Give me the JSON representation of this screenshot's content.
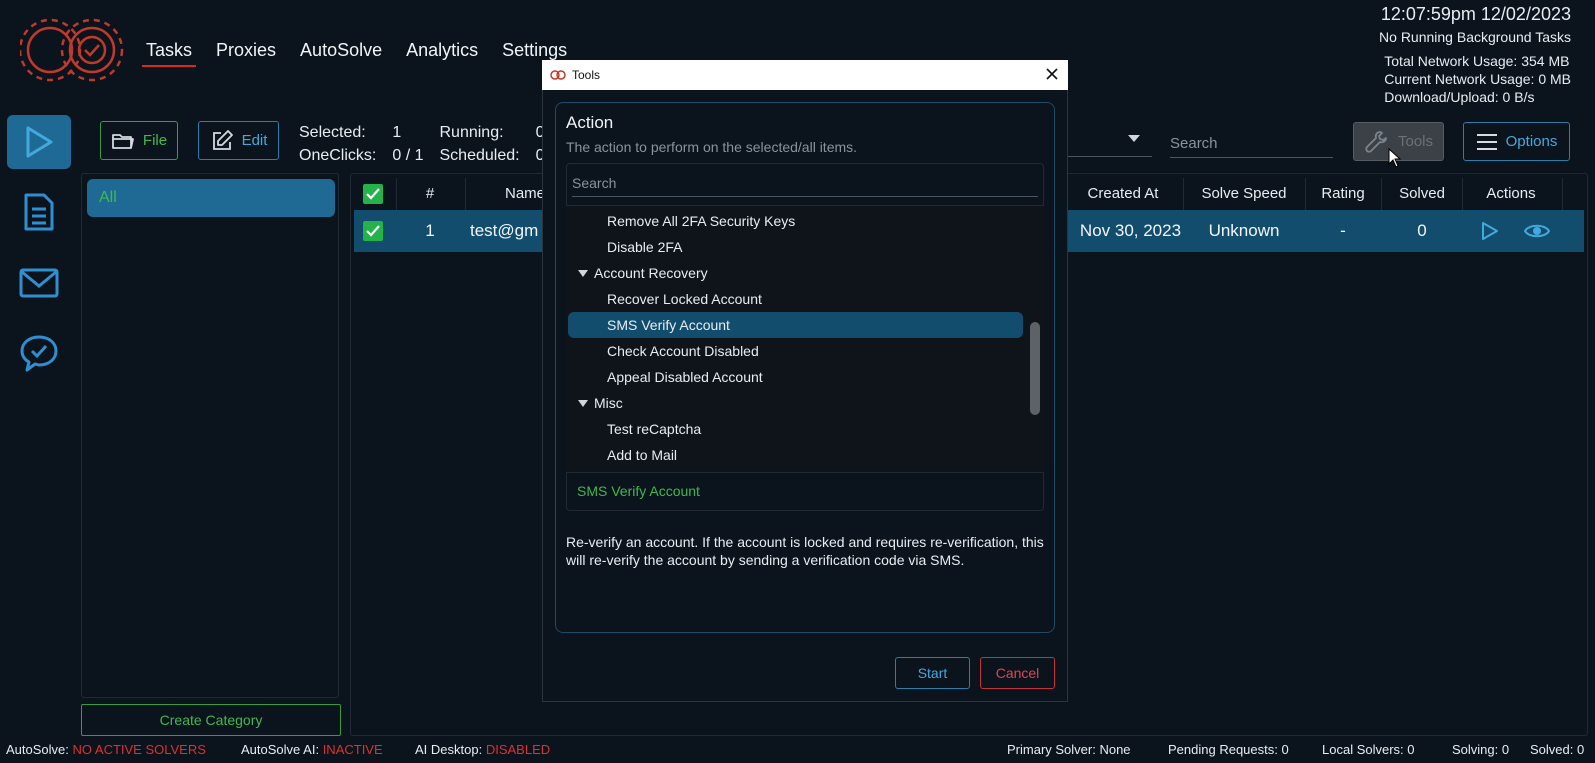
{
  "header": {
    "nav": [
      "Tasks",
      "Proxies",
      "AutoSolve",
      "Analytics",
      "Settings"
    ],
    "active_nav": "Tasks",
    "clock": "12:07:59pm 12/02/2023",
    "background_tasks": "No Running Background Tasks",
    "total_network": "Total Network Usage:  354 MB",
    "current_network": "Current Network Usage: 0 MB",
    "download_upload": "Download/Upload: 0 B/s"
  },
  "sidebar": {
    "icons": [
      "play-icon",
      "document-icon",
      "mail-icon",
      "chat-check-icon"
    ]
  },
  "toolbar": {
    "file_label": "File",
    "edit_label": "Edit",
    "selected_label": "Selected:",
    "selected_value": "1",
    "oneclicks_label": "OneClicks:",
    "oneclicks_value": "0 / 1",
    "running_label": "Running:",
    "running_value": "0",
    "scheduled_label": "Scheduled:",
    "scheduled_value": "0",
    "search_placeholder": "Search",
    "tools_label": "Tools",
    "options_label": "Options"
  },
  "categories": {
    "items": [
      "All"
    ],
    "create_label": "Create Category"
  },
  "table": {
    "columns": [
      "#",
      "Name",
      "Created At",
      "Solve Speed",
      "Rating",
      "Solved",
      "Actions"
    ],
    "rows": [
      {
        "num": "1",
        "name": "test@gm",
        "created_at": "Nov 30, 2023",
        "solve_speed": "Unknown",
        "rating": "-",
        "solved": "0"
      }
    ]
  },
  "modal": {
    "title": "Tools",
    "group_title": "Action",
    "group_subtitle": "The action to perform on the selected/all items.",
    "search_placeholder": "Search",
    "items": [
      {
        "type": "child",
        "label": "Remove All 2FA Security Keys"
      },
      {
        "type": "child",
        "label": "Disable 2FA"
      },
      {
        "type": "group",
        "label": "Account Recovery"
      },
      {
        "type": "child",
        "label": "Recover Locked Account"
      },
      {
        "type": "child",
        "label": "SMS Verify Account",
        "selected": true
      },
      {
        "type": "child",
        "label": "Check Account Disabled"
      },
      {
        "type": "child",
        "label": "Appeal Disabled Account"
      },
      {
        "type": "group",
        "label": "Misc"
      },
      {
        "type": "child",
        "label": "Test reCaptcha"
      },
      {
        "type": "child",
        "label": "Add to Mail"
      }
    ],
    "selected_action": "SMS Verify Account",
    "description": "Re-verify an account. If the account is locked and requires re-verification, this will re-verify the account by sending a verification code via SMS.",
    "start_label": "Start",
    "cancel_label": "Cancel"
  },
  "status_bar": {
    "autosolve_label": "AutoSolve:",
    "autosolve_value": "NO ACTIVE SOLVERS",
    "autosolve_ai_label": "AutoSolve AI:",
    "autosolve_ai_value": "INACTIVE",
    "ai_desktop_label": "AI Desktop:",
    "ai_desktop_value": "DISABLED",
    "primary_solver": "Primary Solver: None",
    "pending_requests": "Pending Requests: 0",
    "local_solvers": "Local Solvers: 0",
    "solving": "Solving: 0",
    "solved": "Solved: 0"
  },
  "colors": {
    "accent_blue": "#1e6a94",
    "accent_green": "#3fb950",
    "accent_red": "#d62828",
    "background": "#0b131c"
  }
}
